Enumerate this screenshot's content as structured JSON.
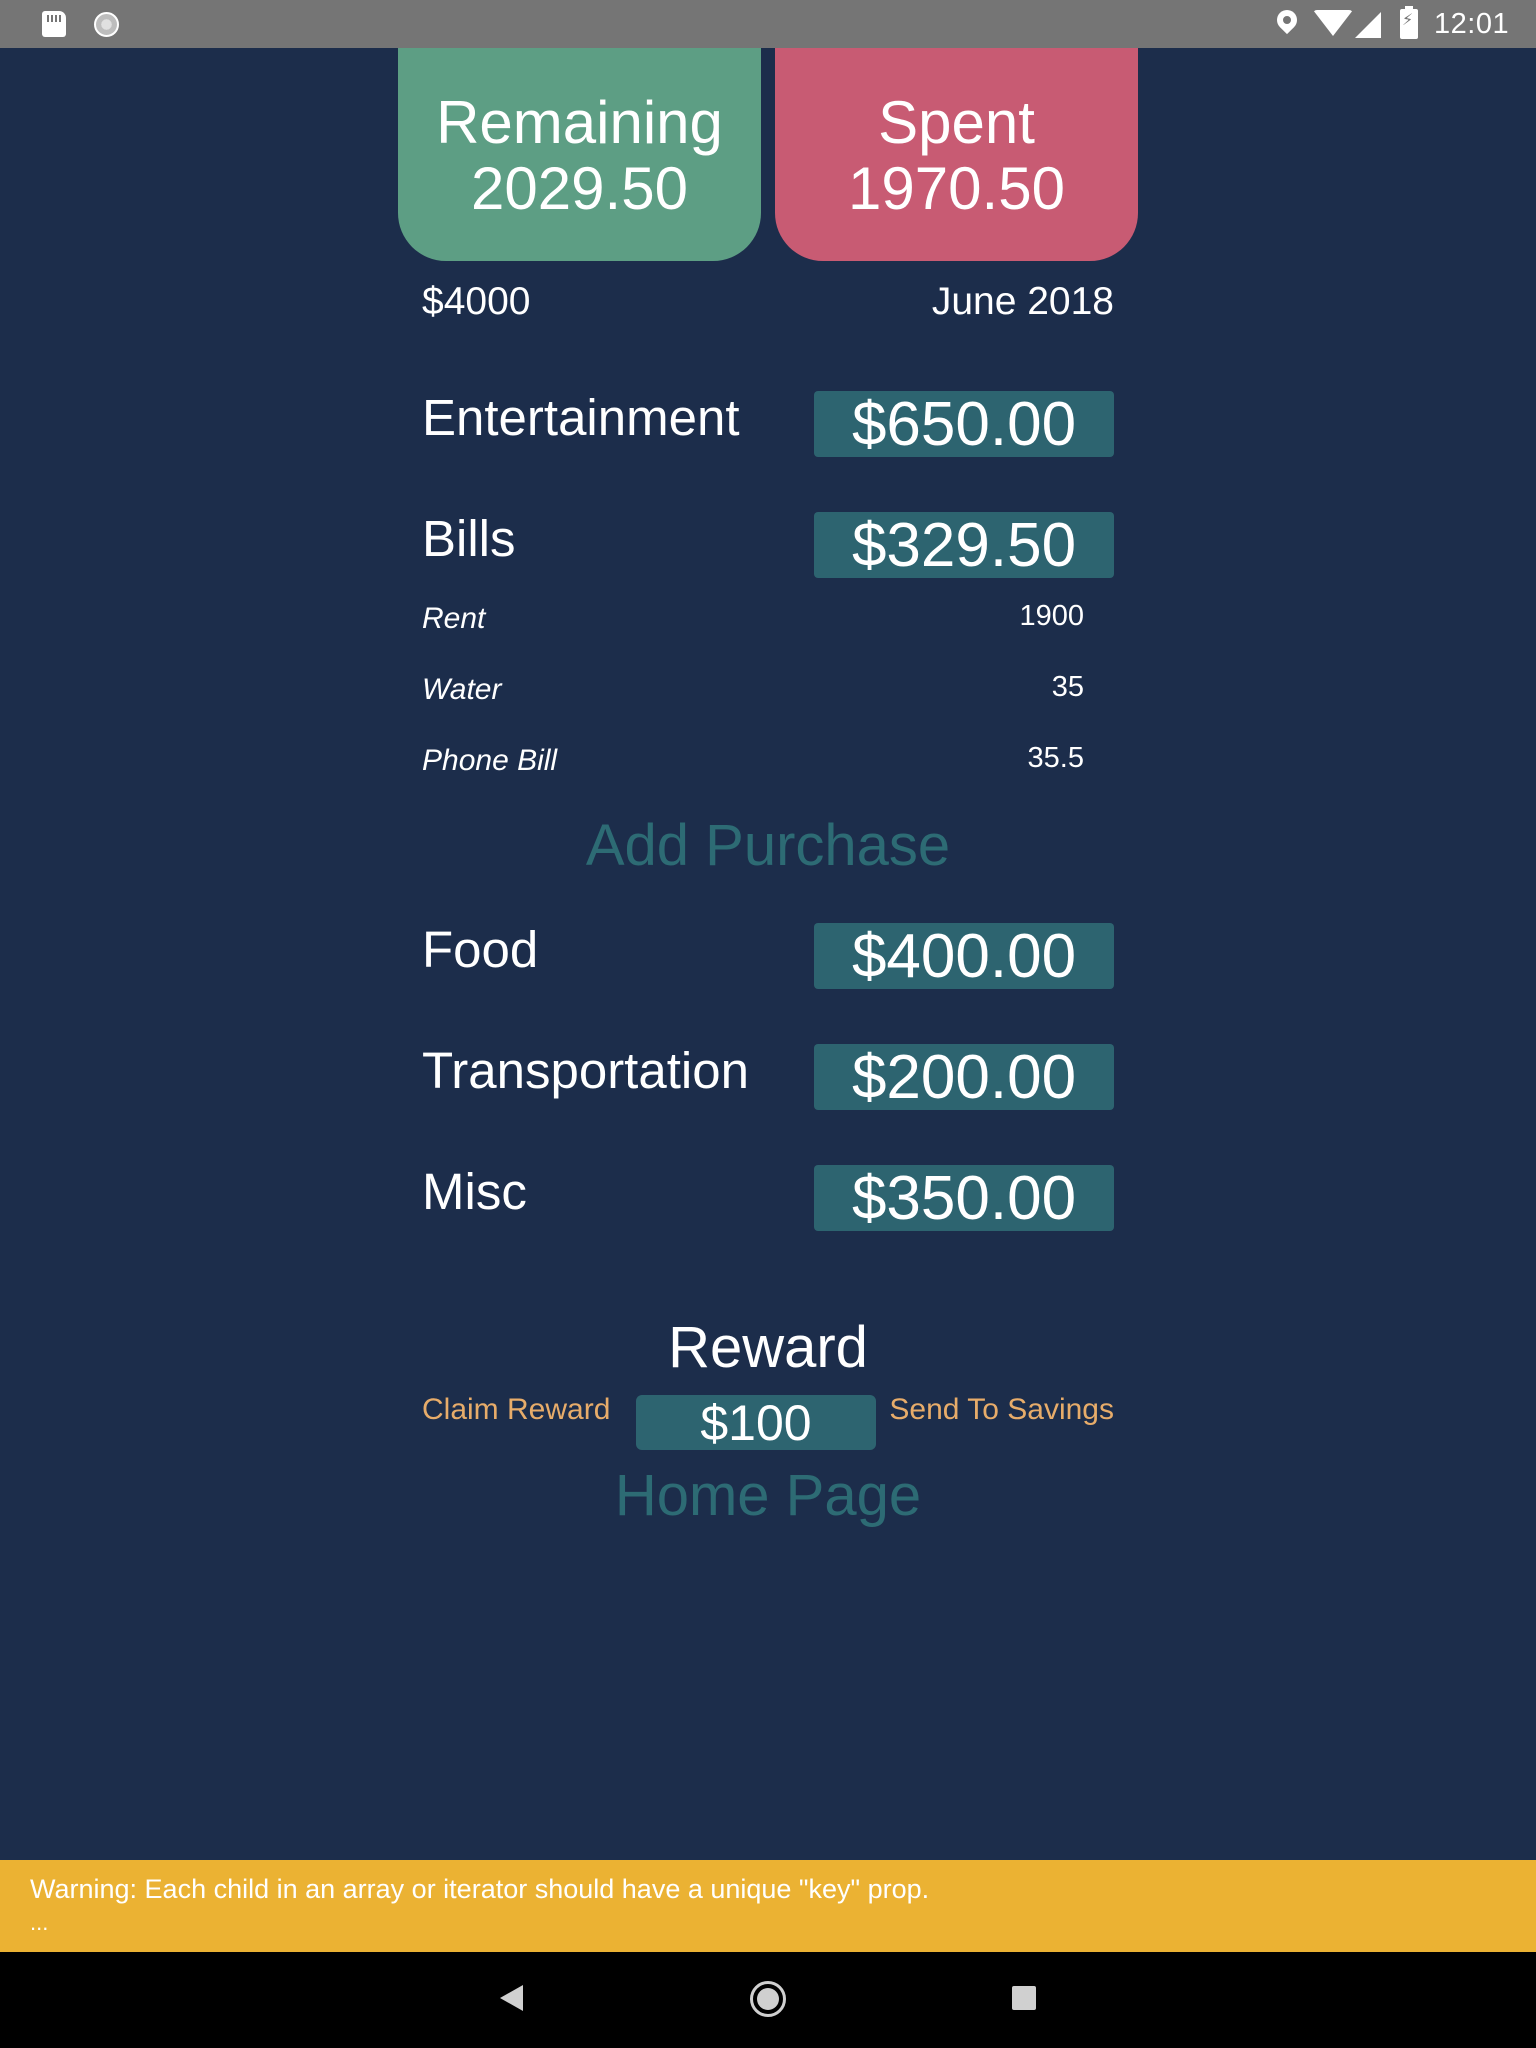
{
  "status_bar": {
    "time": "12:01"
  },
  "cards": {
    "remaining_label": "Remaining",
    "remaining_value": "2029.50",
    "spent_label": "Spent",
    "spent_value": "1970.50"
  },
  "budget": {
    "amount": "$4000",
    "month": "June 2018"
  },
  "categories": [
    {
      "label": "Entertainment",
      "value": "$650.00"
    },
    {
      "label": "Bills",
      "value": "$329.50"
    },
    {
      "label": "Food",
      "value": "$400.00"
    },
    {
      "label": "Transportation",
      "value": "$200.00"
    },
    {
      "label": "Misc",
      "value": "$350.00"
    }
  ],
  "bills_items": [
    {
      "name": "Rent",
      "value": "1900"
    },
    {
      "name": "Water",
      "value": "35"
    },
    {
      "name": "Phone Bill",
      "value": "35.5"
    }
  ],
  "add_purchase": "Add Purchase",
  "reward": {
    "title": "Reward",
    "claim": "Claim Reward",
    "value": "$100",
    "savings": "Send To Savings"
  },
  "home_page": "Home Page",
  "warning": {
    "text": "Warning: Each child in an array or iterator should have a unique \"key\" prop.",
    "dots": "..."
  },
  "colors": {
    "background": "#1c2d4b",
    "remaining": "#5d9e84",
    "spent": "#c85b73",
    "value_box": "#2d6470",
    "link": "#2d6b74",
    "reward_actions": "#e7ac6a",
    "warning": "#ebb233"
  }
}
